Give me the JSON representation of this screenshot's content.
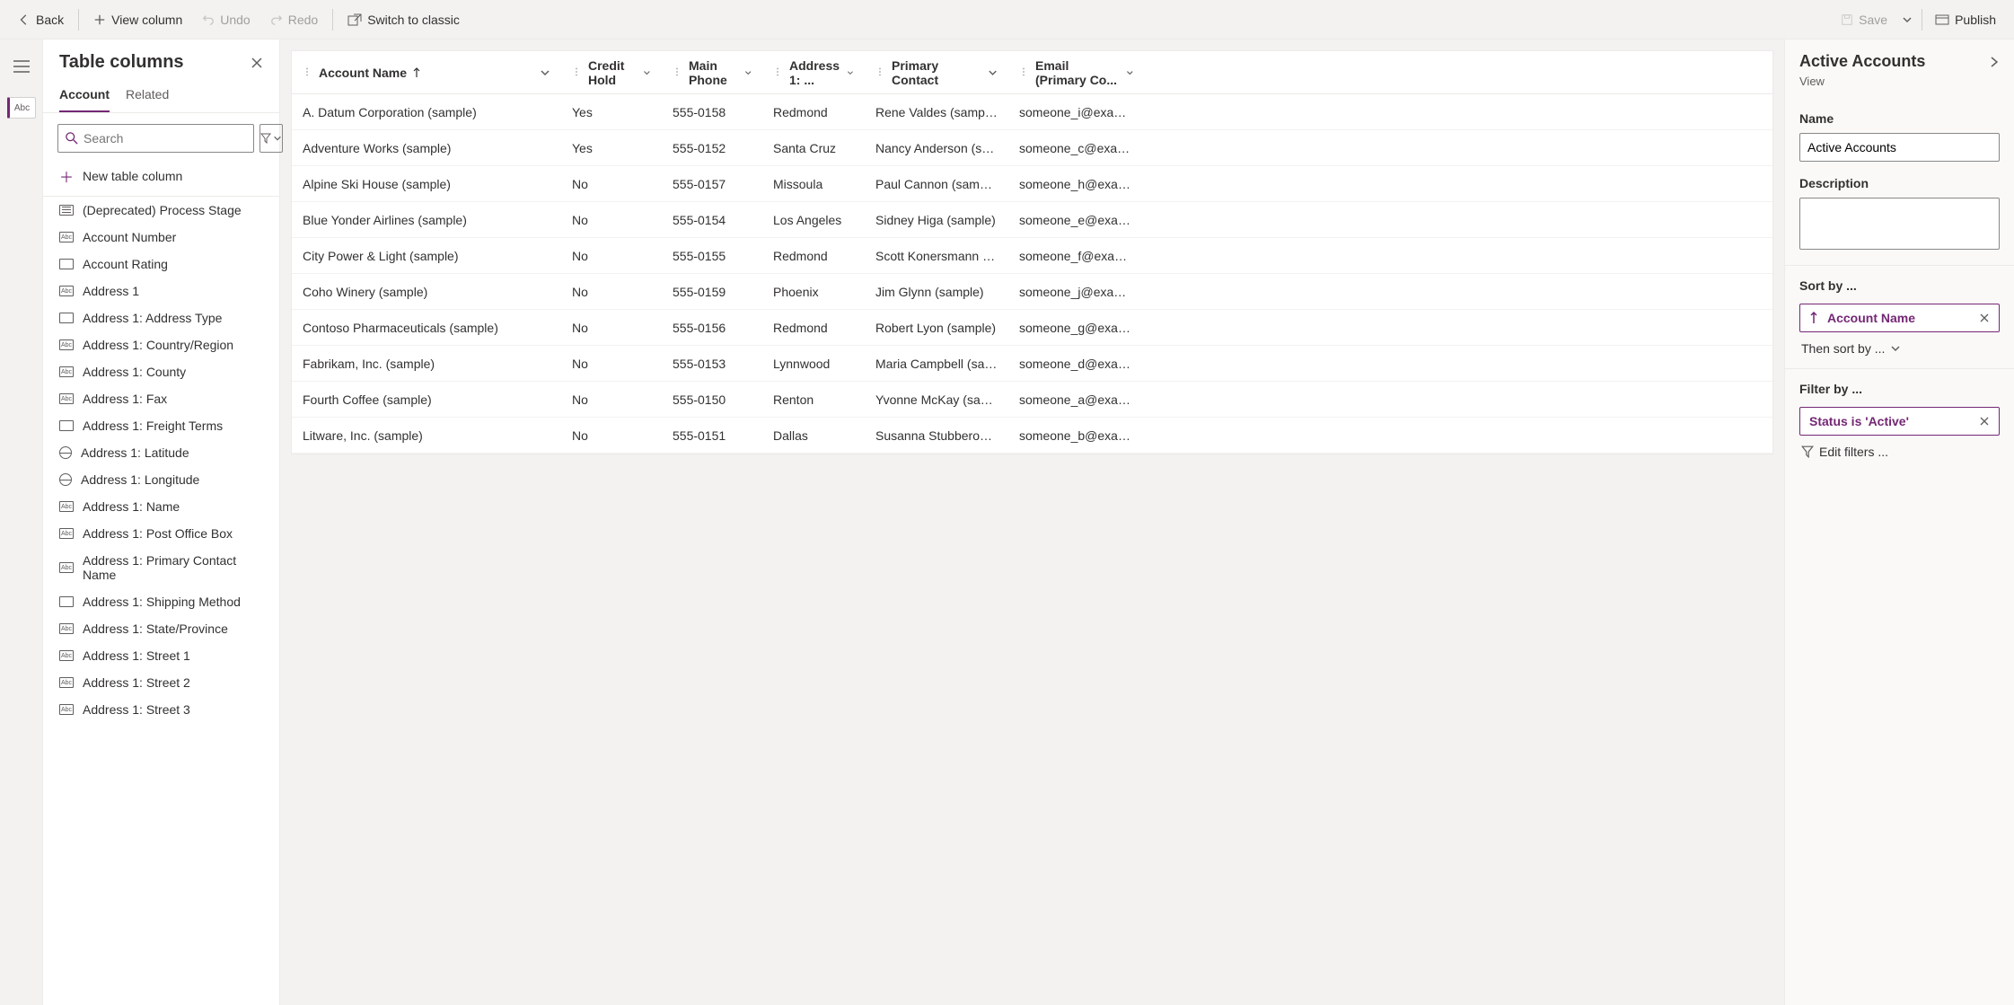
{
  "toolbar": {
    "back": "Back",
    "view_column": "View column",
    "undo": "Undo",
    "redo": "Redo",
    "switch": "Switch to classic",
    "save": "Save",
    "publish": "Publish"
  },
  "columns_panel": {
    "title": "Table columns",
    "tabs": {
      "account": "Account",
      "related": "Related"
    },
    "search_placeholder": "Search",
    "new_column": "New table column",
    "items": [
      {
        "label": "(Deprecated) Process Stage",
        "icon": "lines"
      },
      {
        "label": "Account Number",
        "icon": "abc"
      },
      {
        "label": "Account Rating",
        "icon": "box"
      },
      {
        "label": "Address 1",
        "icon": "abc"
      },
      {
        "label": "Address 1: Address Type",
        "icon": "box"
      },
      {
        "label": "Address 1: Country/Region",
        "icon": "abc"
      },
      {
        "label": "Address 1: County",
        "icon": "abc"
      },
      {
        "label": "Address 1: Fax",
        "icon": "abc"
      },
      {
        "label": "Address 1: Freight Terms",
        "icon": "box"
      },
      {
        "label": "Address 1: Latitude",
        "icon": "globe"
      },
      {
        "label": "Address 1: Longitude",
        "icon": "globe"
      },
      {
        "label": "Address 1: Name",
        "icon": "abc"
      },
      {
        "label": "Address 1: Post Office Box",
        "icon": "abc"
      },
      {
        "label": "Address 1: Primary Contact Name",
        "icon": "abc"
      },
      {
        "label": "Address 1: Shipping Method",
        "icon": "box"
      },
      {
        "label": "Address 1: State/Province",
        "icon": "abc"
      },
      {
        "label": "Address 1: Street 1",
        "icon": "abc"
      },
      {
        "label": "Address 1: Street 2",
        "icon": "abc"
      },
      {
        "label": "Address 1: Street 3",
        "icon": "abc"
      }
    ]
  },
  "grid": {
    "headers": {
      "name": "Account Name",
      "credit": "Credit Hold",
      "phone": "Main Phone",
      "addr": "Address 1: ...",
      "contact": "Primary Contact",
      "email": "Email (Primary Co..."
    },
    "rows": [
      {
        "name": "A. Datum Corporation (sample)",
        "credit": "Yes",
        "phone": "555-0158",
        "addr": "Redmond",
        "contact": "Rene Valdes (sample)",
        "email": "someone_i@example.com"
      },
      {
        "name": "Adventure Works (sample)",
        "credit": "Yes",
        "phone": "555-0152",
        "addr": "Santa Cruz",
        "contact": "Nancy Anderson (sample)",
        "email": "someone_c@example.com"
      },
      {
        "name": "Alpine Ski House (sample)",
        "credit": "No",
        "phone": "555-0157",
        "addr": "Missoula",
        "contact": "Paul Cannon (sample)",
        "email": "someone_h@example.com"
      },
      {
        "name": "Blue Yonder Airlines (sample)",
        "credit": "No",
        "phone": "555-0154",
        "addr": "Los Angeles",
        "contact": "Sidney Higa (sample)",
        "email": "someone_e@example.com"
      },
      {
        "name": "City Power & Light (sample)",
        "credit": "No",
        "phone": "555-0155",
        "addr": "Redmond",
        "contact": "Scott Konersmann (sample)",
        "email": "someone_f@example.com"
      },
      {
        "name": "Coho Winery (sample)",
        "credit": "No",
        "phone": "555-0159",
        "addr": "Phoenix",
        "contact": "Jim Glynn (sample)",
        "email": "someone_j@example.com"
      },
      {
        "name": "Contoso Pharmaceuticals (sample)",
        "credit": "No",
        "phone": "555-0156",
        "addr": "Redmond",
        "contact": "Robert Lyon (sample)",
        "email": "someone_g@example.com"
      },
      {
        "name": "Fabrikam, Inc. (sample)",
        "credit": "No",
        "phone": "555-0153",
        "addr": "Lynnwood",
        "contact": "Maria Campbell (sample)",
        "email": "someone_d@example.com"
      },
      {
        "name": "Fourth Coffee (sample)",
        "credit": "No",
        "phone": "555-0150",
        "addr": "Renton",
        "contact": "Yvonne McKay (sample)",
        "email": "someone_a@example.com"
      },
      {
        "name": "Litware, Inc. (sample)",
        "credit": "No",
        "phone": "555-0151",
        "addr": "Dallas",
        "contact": "Susanna Stubberod (sampl...",
        "email": "someone_b@example.com"
      }
    ]
  },
  "right": {
    "title": "Active Accounts",
    "subtitle": "View",
    "name_label": "Name",
    "name_value": "Active Accounts",
    "desc_label": "Description",
    "desc_value": "",
    "sort_label": "Sort by ...",
    "sort_chip": "Account Name",
    "then_sort": "Then sort by ...",
    "filter_label": "Filter by ...",
    "filter_chip": "Status is 'Active'",
    "edit_filters": "Edit filters ..."
  }
}
